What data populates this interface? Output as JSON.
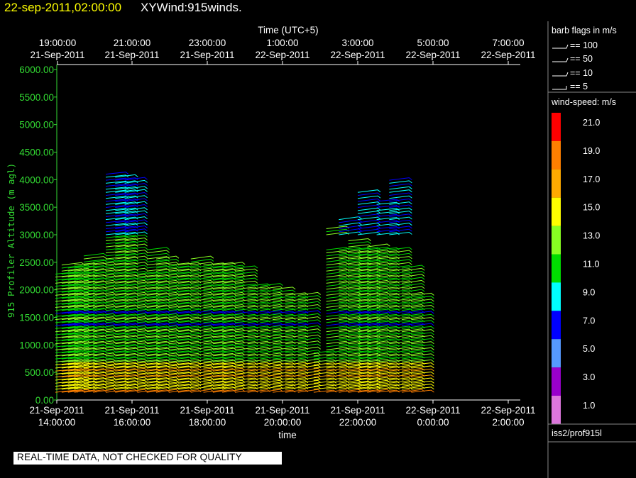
{
  "header": {
    "date_time": "22-sep-2011,02:00:00",
    "product": "XYWind:915winds."
  },
  "footer": {
    "quality_note": "REAL-TIME DATA, NOT CHECKED FOR QUALITY"
  },
  "legend": {
    "barb_title": "barb flags in m/s",
    "barb_items": [
      "== 100",
      "== 50",
      "== 10",
      "== 5"
    ],
    "speed_title": "wind-speed: m/s",
    "station": "iss2/prof915l"
  },
  "chart_data": {
    "type": "wind-barb time-height",
    "title": "22-sep-2011,02:00:00  XYWind:915winds.",
    "xlabel": "time",
    "x2label": "Time (UTC+5)",
    "ylabel": "915 Profiler Altitude (m agl)",
    "ylim": [
      0,
      6000
    ],
    "yticks": [
      "0.00",
      "500.00",
      "1000.00",
      "1500.00",
      "2000.00",
      "2500.00",
      "3000.00",
      "3500.00",
      "4000.00",
      "4500.00",
      "5000.00",
      "5500.00",
      "6000.00"
    ],
    "xticks_bottom": [
      {
        "date": "21-Sep-2011",
        "time": "14:00:00"
      },
      {
        "date": "21-Sep-2011",
        "time": "16:00:00"
      },
      {
        "date": "21-Sep-2011",
        "time": "18:00:00"
      },
      {
        "date": "21-Sep-2011",
        "time": "20:00:00"
      },
      {
        "date": "21-Sep-2011",
        "time": "22:00:00"
      },
      {
        "date": "22-Sep-2011",
        "time": "0:00:00"
      },
      {
        "date": "22-Sep-2011",
        "time": "2:00:00"
      }
    ],
    "xticks_top": [
      {
        "time": "19:00:00",
        "date": "21-Sep-2011"
      },
      {
        "time": "21:00:00",
        "date": "21-Sep-2011"
      },
      {
        "time": "23:00:00",
        "date": "21-Sep-2011"
      },
      {
        "time": "1:00:00",
        "date": "22-Sep-2011"
      },
      {
        "time": "3:00:00",
        "date": "22-Sep-2011"
      },
      {
        "time": "5:00:00",
        "date": "22-Sep-2011"
      },
      {
        "time": "7:00:00",
        "date": "22-Sep-2011"
      }
    ],
    "color_scale": [
      {
        "value": "21.0",
        "color": "#ff0000"
      },
      {
        "value": "19.0",
        "color": "#ff7f00"
      },
      {
        "value": "17.0",
        "color": "#ffaa00"
      },
      {
        "value": "15.0",
        "color": "#ffff00"
      },
      {
        "value": "13.0",
        "color": "#88ff22"
      },
      {
        "value": "11.0",
        "color": "#00dd00"
      },
      {
        "value": "9.0",
        "color": "#00ffff"
      },
      {
        "value": "7.0",
        "color": "#0000ff"
      },
      {
        "value": "5.0",
        "color": "#5599ff"
      },
      {
        "value": "3.0",
        "color": "#9900cc"
      },
      {
        "value": "1.0",
        "color": "#dd77dd"
      }
    ],
    "profiles": [
      {
        "time": "14:00",
        "top": 2300,
        "upper": []
      },
      {
        "time": "14:10",
        "top": 2450,
        "upper": []
      },
      {
        "time": "14:20",
        "top": 2420,
        "upper": []
      },
      {
        "time": "14:30",
        "top": 2450,
        "upper": []
      },
      {
        "time": "14:45",
        "top": 2650,
        "upper": []
      },
      {
        "time": "15:00",
        "top": 2520,
        "upper": []
      },
      {
        "time": "15:20",
        "top": 4100,
        "upper": [
          3300
        ]
      },
      {
        "time": "15:35",
        "top": 4050,
        "upper": [
          3300
        ]
      },
      {
        "time": "15:50",
        "top": 4020,
        "upper": [
          3200
        ]
      },
      {
        "time": "16:10",
        "top": 2300,
        "upper": []
      },
      {
        "time": "16:25",
        "top": 2750,
        "upper": []
      },
      {
        "time": "16:40",
        "top": 2600,
        "upper": []
      },
      {
        "time": "17:00",
        "top": 2500,
        "upper": []
      },
      {
        "time": "17:15",
        "top": 2450,
        "upper": []
      },
      {
        "time": "17:35",
        "top": 2600,
        "upper": []
      },
      {
        "time": "17:55",
        "top": 2500,
        "upper": []
      },
      {
        "time": "18:10",
        "top": 2450,
        "upper": []
      },
      {
        "time": "18:25",
        "top": 2450,
        "upper": []
      },
      {
        "time": "18:45",
        "top": 2400,
        "upper": []
      },
      {
        "time": "19:05",
        "top": 2100,
        "upper": []
      },
      {
        "time": "19:25",
        "top": 2100,
        "upper": []
      },
      {
        "time": "19:45",
        "top": 2050,
        "upper": []
      },
      {
        "time": "20:05",
        "top": 1950,
        "upper": []
      },
      {
        "time": "20:25",
        "top": 1950,
        "upper": []
      },
      {
        "time": "20:50",
        "top": 900,
        "upper": []
      },
      {
        "time": "21:10",
        "top": 3150,
        "upper": []
      },
      {
        "time": "21:30",
        "top": 3300,
        "upper": []
      },
      {
        "time": "21:45",
        "top": 2900,
        "upper": []
      },
      {
        "time": "22:00",
        "top": 3800,
        "upper": []
      },
      {
        "time": "22:15",
        "top": 2800,
        "upper": []
      },
      {
        "time": "22:30",
        "top": 3650,
        "upper": []
      },
      {
        "time": "22:50",
        "top": 4000,
        "upper": []
      },
      {
        "time": "23:10",
        "top": 2400,
        "upper": []
      },
      {
        "time": "23:25",
        "top": 1950,
        "upper": []
      }
    ]
  }
}
